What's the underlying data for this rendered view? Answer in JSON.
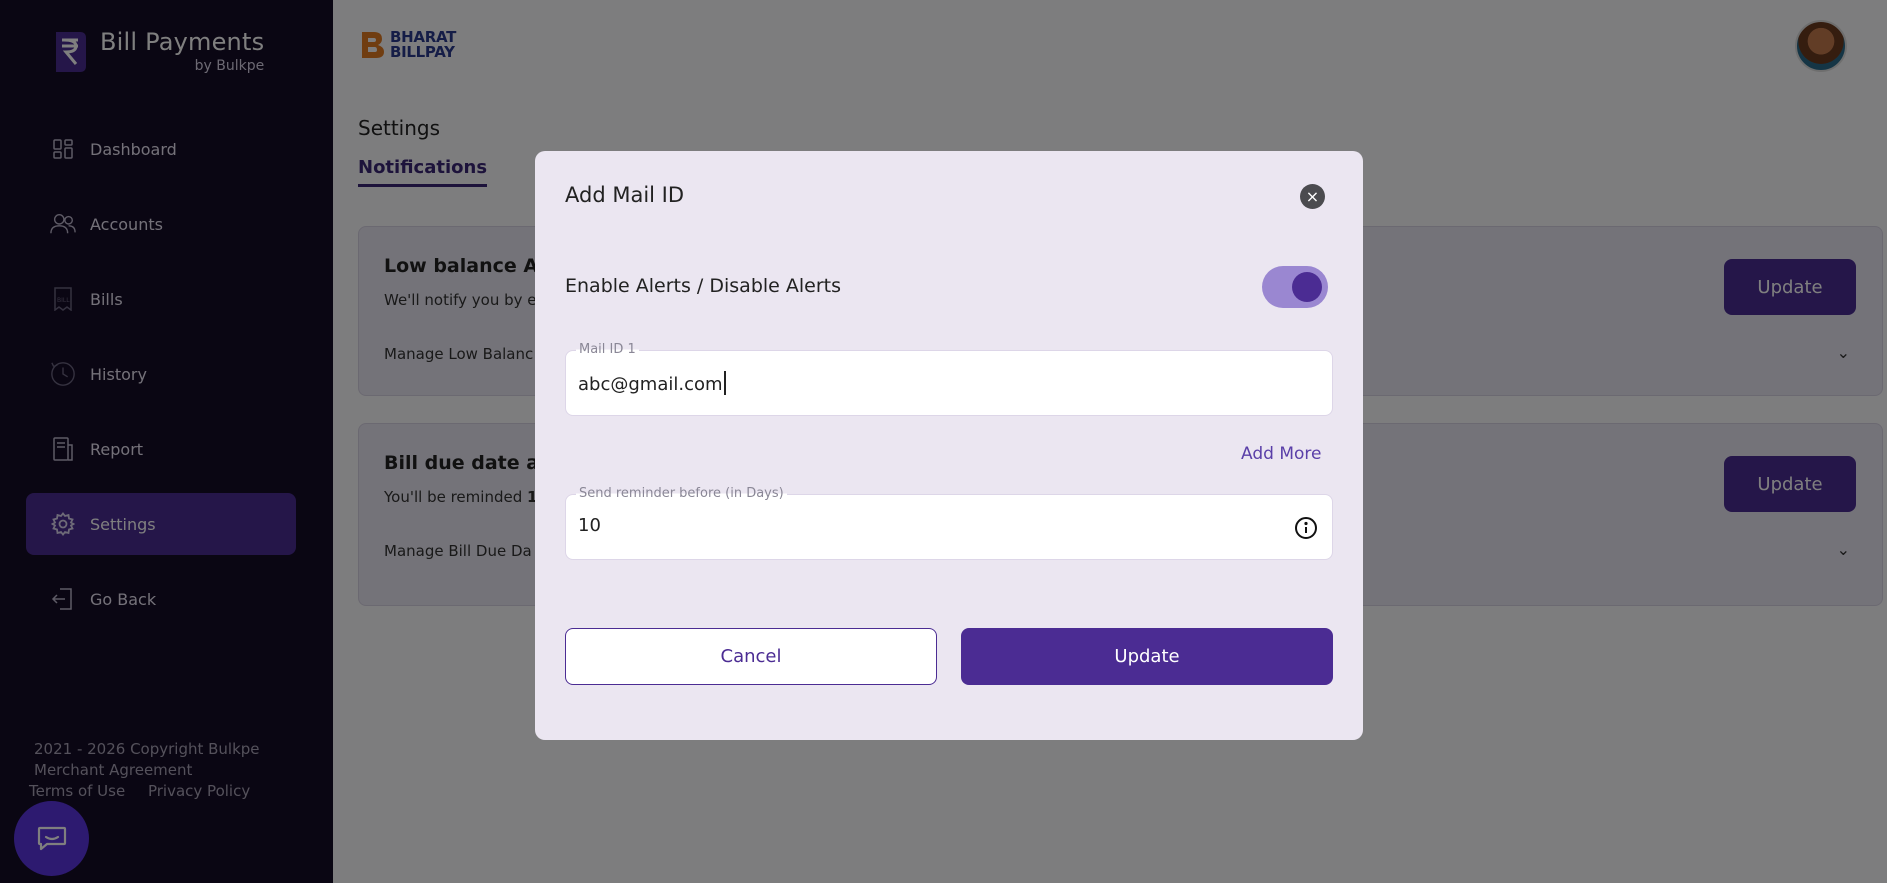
{
  "brand": {
    "title": "Bill Payments",
    "subtitle": "by Bulkpe"
  },
  "sidebar": {
    "items": [
      {
        "label": "Dashboard",
        "icon": "dashboard-icon"
      },
      {
        "label": "Accounts",
        "icon": "users-icon"
      },
      {
        "label": "Bills",
        "icon": "bill-icon"
      },
      {
        "label": "History",
        "icon": "history-icon"
      },
      {
        "label": "Report",
        "icon": "report-icon"
      },
      {
        "label": "Settings",
        "icon": "gear-icon",
        "active": true
      },
      {
        "label": "Go Back",
        "icon": "logout-icon"
      }
    ],
    "footer": {
      "copyright": "2021 - 2026 Copyright Bulkpe",
      "agreement": "Merchant Agreement",
      "terms": "Terms of Use",
      "privacy": "Privacy Policy"
    }
  },
  "header": {
    "partner_logo_line1": "BHARAT",
    "partner_logo_line2": "BILLPAY"
  },
  "page": {
    "title": "Settings",
    "tab": "Notifications",
    "cards": [
      {
        "title": "Low balance Ale",
        "desc": "We'll notify you by e",
        "manage": "Manage Low Balanc",
        "button": "Update"
      },
      {
        "title": "Bill due date ale",
        "desc_prefix": "You'll be reminded ",
        "desc_bold": "1",
        "manage": "Manage Bill Due Da",
        "button": "Update"
      }
    ]
  },
  "modal": {
    "title": "Add Mail ID",
    "toggle_label": "Enable Alerts / Disable Alerts",
    "toggle_on": true,
    "mail_field": {
      "label": "Mail ID 1",
      "value": "abc@gmail.com"
    },
    "add_more": "Add More",
    "reminder_field": {
      "label": "Send reminder before (in Days)",
      "value": "10"
    },
    "cancel": "Cancel",
    "update": "Update"
  },
  "colors": {
    "primary": "#4b2c93",
    "sidebar_bg": "#150c26",
    "modal_bg": "#ebe6f1"
  }
}
